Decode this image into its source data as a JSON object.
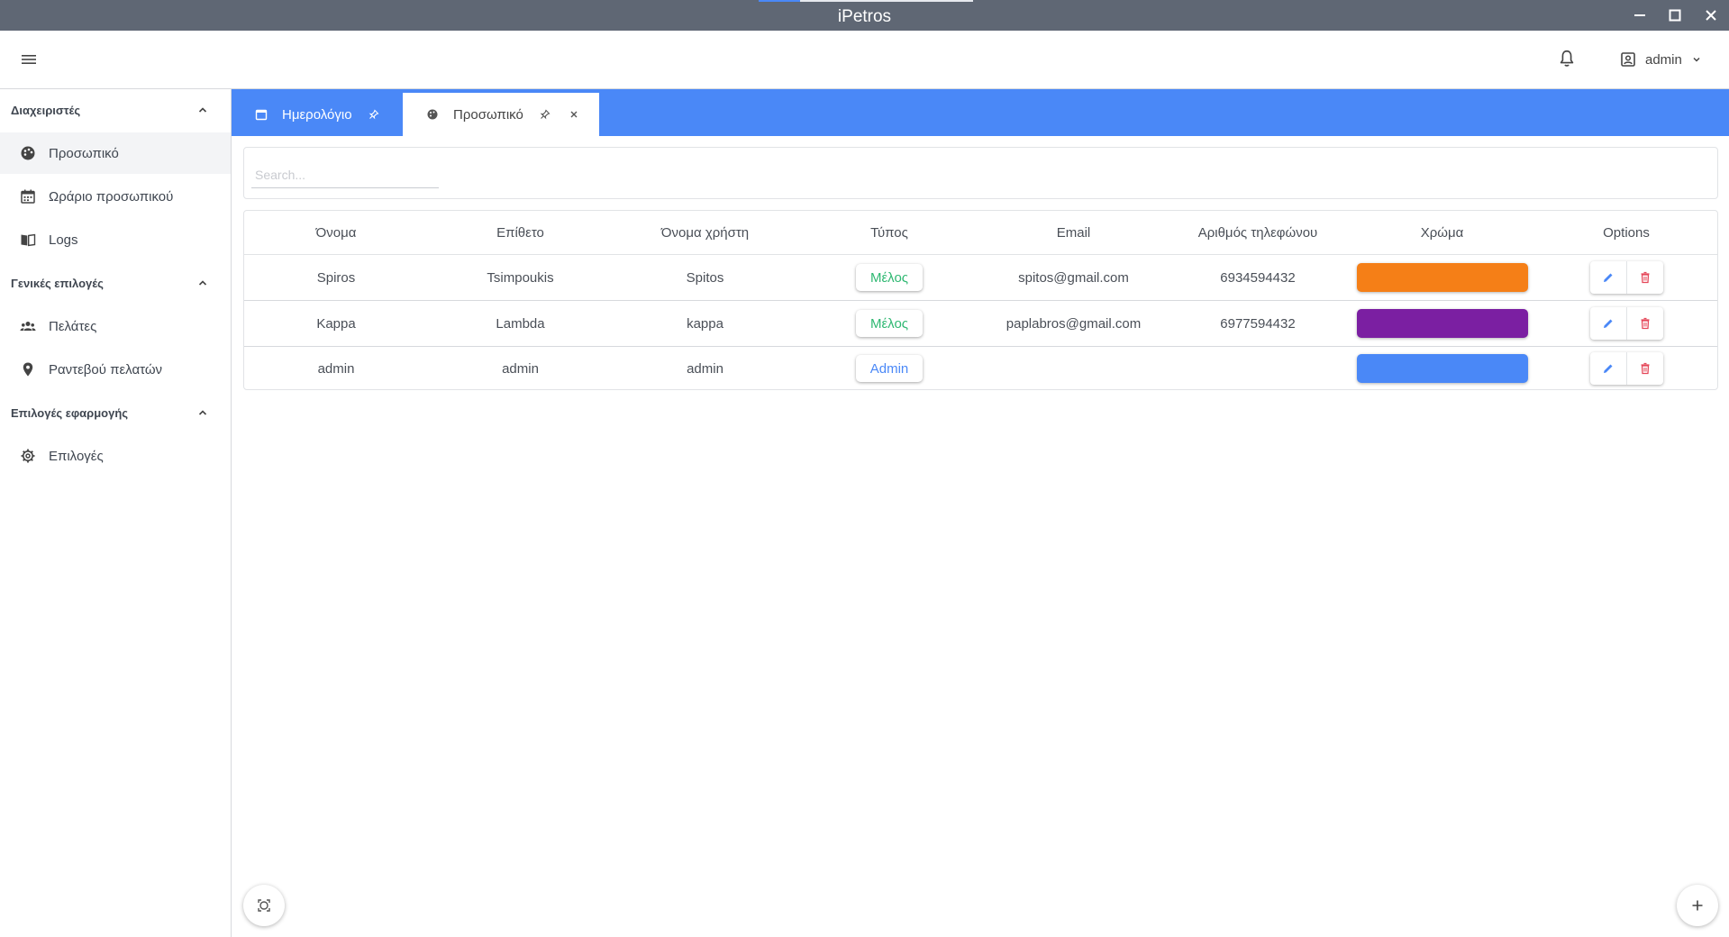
{
  "window": {
    "title": "iPetros"
  },
  "header": {
    "user_name": "admin"
  },
  "sidebar": {
    "sections": [
      {
        "title": "Διαχειριστές",
        "items": [
          {
            "label": "Προσωπικό",
            "icon": "palette-icon",
            "active": true
          },
          {
            "label": "Ωράριο προσωπικού",
            "icon": "calendar-icon"
          },
          {
            "label": "Logs",
            "icon": "book-icon"
          }
        ]
      },
      {
        "title": "Γενικές επιλογές",
        "items": [
          {
            "label": "Πελάτες",
            "icon": "users-icon"
          },
          {
            "label": "Ραντεβού πελατών",
            "icon": "map-pin-icon"
          }
        ]
      },
      {
        "title": "Επιλογές εφαρμογής",
        "items": [
          {
            "label": "Επιλογές",
            "icon": "gear-icon"
          }
        ]
      }
    ]
  },
  "tabs": [
    {
      "label": "Ημερολόγιο",
      "icon": "calendar-icon",
      "active": false
    },
    {
      "label": "Προσωπικό",
      "icon": "palette-icon",
      "active": true
    }
  ],
  "search": {
    "placeholder": "Search..."
  },
  "table": {
    "headers": [
      "Όνομα",
      "Επίθετο",
      "Όνομα χρήστη",
      "Τύπος",
      "Email",
      "Αριθμός τηλεφώνου",
      "Χρώμα",
      "Options"
    ],
    "rows": [
      {
        "first_name": "Spiros",
        "last_name": "Tsimpoukis",
        "username": "Spitos",
        "type": "Μέλος",
        "type_color": "#2fb872",
        "email": "spitos@gmail.com",
        "phone": "6934594432",
        "color": "#f57f17"
      },
      {
        "first_name": "Kappa",
        "last_name": "Lambda",
        "username": "kappa",
        "type": "Μέλος",
        "type_color": "#2fb872",
        "email": "paplabros@gmail.com",
        "phone": "6977594432",
        "color": "#7b1fa2"
      },
      {
        "first_name": "admin",
        "last_name": "admin",
        "username": "admin",
        "type": "Admin",
        "type_color": "#4a88f7",
        "email": "",
        "phone": "",
        "color": "#4a88f7"
      }
    ]
  },
  "colors": {
    "accent": "#4a88f7",
    "titlebar": "#5f6774",
    "edit": "#4a88f7",
    "delete": "#e5485a"
  }
}
